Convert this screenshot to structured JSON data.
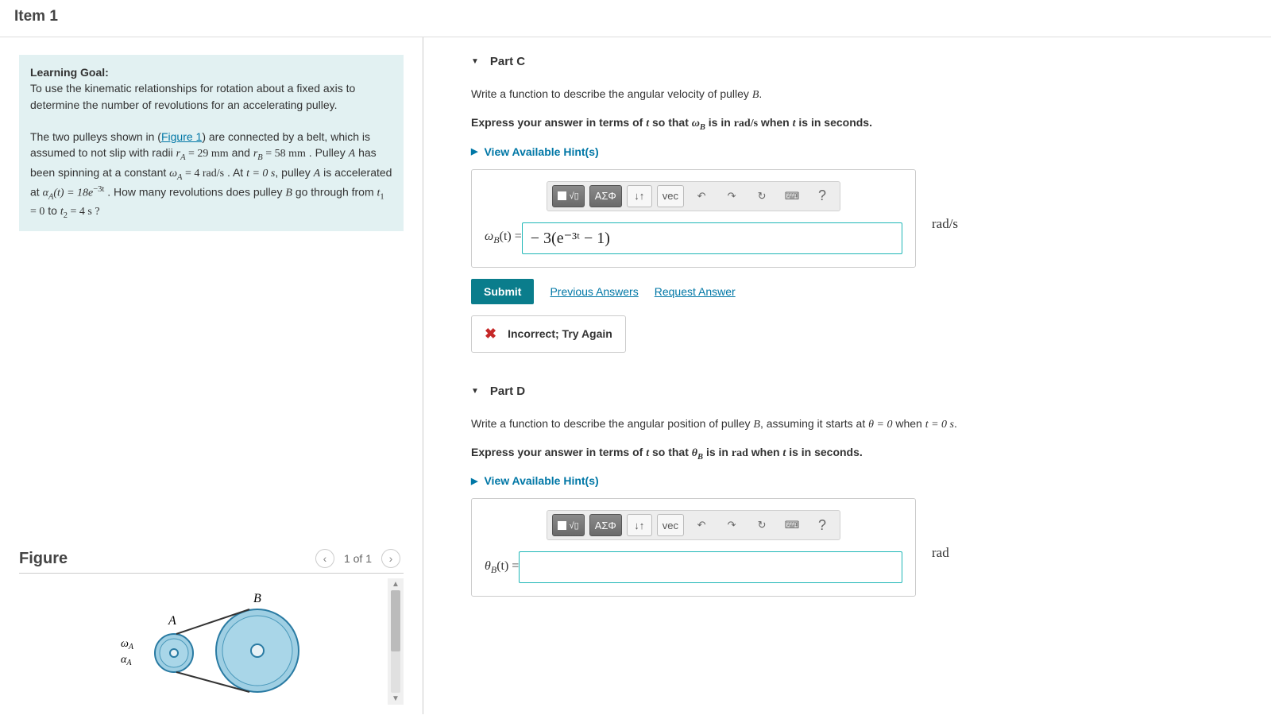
{
  "header": {
    "title": "Item 1"
  },
  "goal": {
    "label": "Learning Goal:",
    "line1": "To use the kinematic relationships for rotation about a fixed axis to determine the number of revolutions for an accelerating pulley.",
    "para2_a": "The two pulleys shown in (",
    "figure_link": "Figure 1",
    "para2_b": ") are connected by a belt, which is assumed to not slip with radii ",
    "rA_lhs": "r",
    "rA_sub": "A",
    "rA_eq": " = 29 mm",
    "and": " and ",
    "rB_lhs": "r",
    "rB_sub": "B",
    "rB_eq": " = 58 mm",
    "pulleyA": " . Pulley ",
    "pulleyA_sym": "A",
    "spin": " has been spinning at a constant ",
    "wA_lhs": "ω",
    "wA_sub": "A",
    "wA_eq": " = 4 rad/s",
    "att0": " . At ",
    "t0": "t = 0 s",
    "pulleyA2": ", pulley ",
    "pulleyA2_sym": "A",
    "accel": " is accelerated at ",
    "alpha_lhs": "α",
    "alpha_sub": "A",
    "alpha_fn": "(t) = 18e",
    "alpha_exp": "−3t",
    "question": " . How many revolutions does pulley ",
    "B_sym": "B",
    "through": " go through from ",
    "t1": "t",
    "t1_sub": "1",
    "t1_eq": " = 0",
    "to": " to ",
    "t2": "t",
    "t2_sub": "2",
    "t2_eq": " = 4 s ?"
  },
  "figure": {
    "title": "Figure",
    "counter": "1 of 1",
    "labelA": "A",
    "labelB": "B",
    "labelW": "ω",
    "labelWsub": "A",
    "labelAlpha": "α",
    "labelAlphasub": "A"
  },
  "partC": {
    "title": "Part C",
    "prompt_a": "Write a function to describe the angular velocity of pulley ",
    "prompt_sym": "B",
    "prompt_b": ".",
    "express_a": "Express your answer in terms of ",
    "express_t": "t",
    "express_b": " so that ",
    "express_wB": "ω",
    "express_wB_sub": "B",
    "express_c": " is in ",
    "express_unit": "rad/s",
    "express_d": " when ",
    "express_t2": "t",
    "express_e": " is in seconds.",
    "hints": "View Available Hint(s)",
    "lhs_w": "ω",
    "lhs_sub": "B",
    "lhs_fn": "(t) = ",
    "input_value": "− 3(e⁻³ᵗ − 1)",
    "units": "rad/s",
    "submit": "Submit",
    "prev": "Previous Answers",
    "request": "Request Answer",
    "feedback": "Incorrect; Try Again"
  },
  "partD": {
    "title": "Part D",
    "prompt_a": "Write a function to describe the angular position of pulley ",
    "prompt_sym": "B",
    "prompt_b": ", assuming it starts at ",
    "theta0": "θ = 0",
    "when": " when ",
    "t0": "t = 0 s",
    "dot": ".",
    "express_a": "Express your answer in terms of ",
    "express_t": "t",
    "express_b": " so that ",
    "express_theta": "θ",
    "express_theta_sub": "B",
    "express_c": " is in ",
    "express_unit": "rad",
    "express_d": " when ",
    "express_t2": "t",
    "express_e": " is in seconds.",
    "hints": "View Available Hint(s)",
    "lhs_th": "θ",
    "lhs_sub": "B",
    "lhs_fn": "(t) = ",
    "input_value": "",
    "units": "rad"
  },
  "toolbar": {
    "templates": "▮√▯",
    "greek": "ΑΣΦ",
    "subsup": "↓↑",
    "vec": "vec",
    "undo": "↶",
    "redo": "↷",
    "reset": "↻",
    "keyboard": "⌨",
    "help": "?"
  }
}
